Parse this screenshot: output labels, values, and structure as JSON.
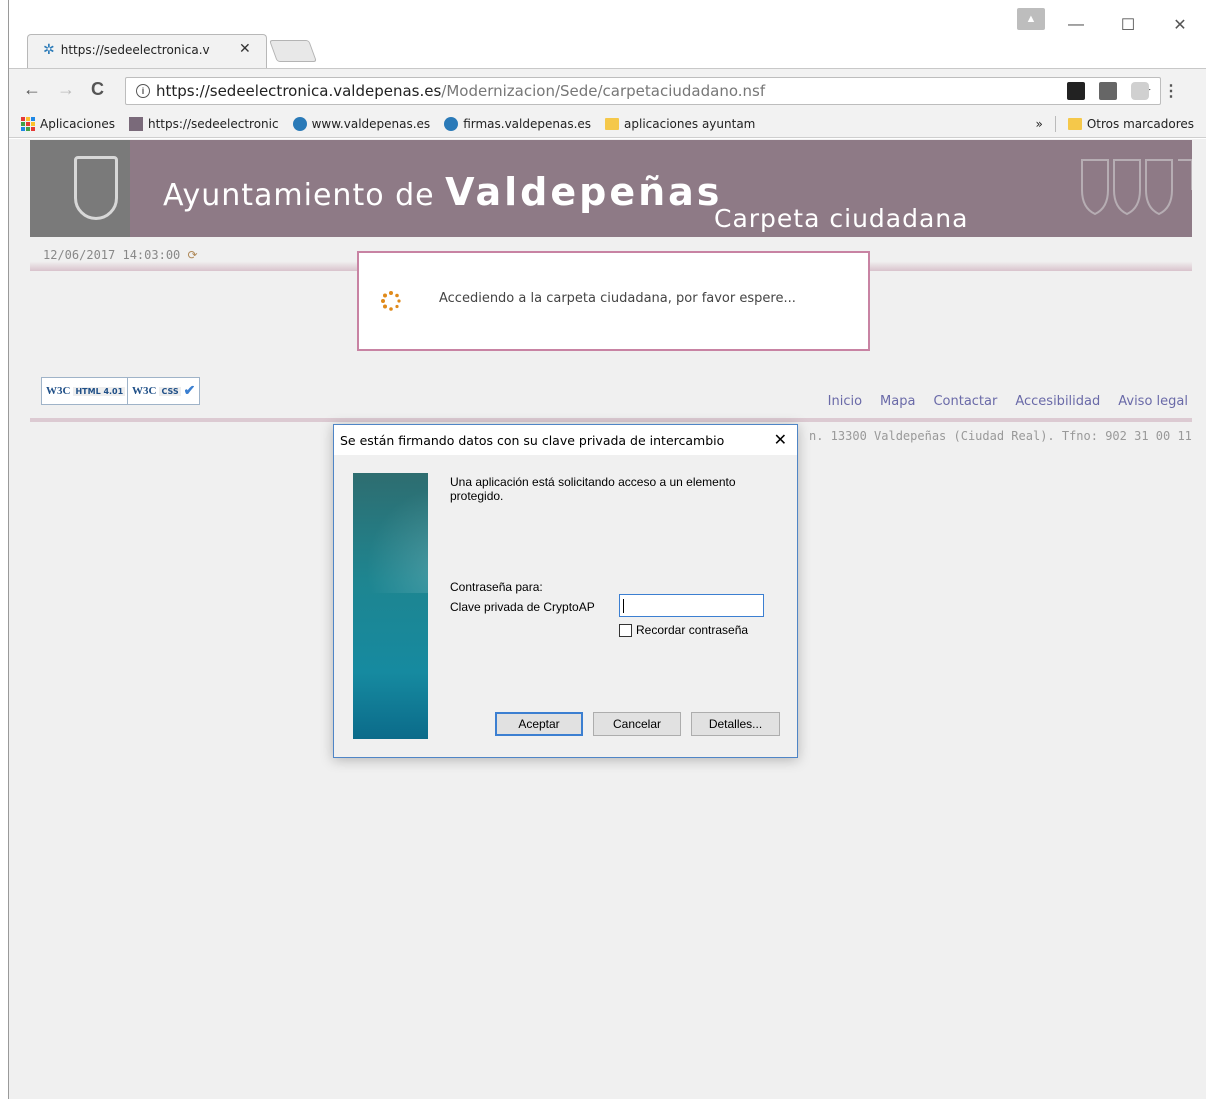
{
  "browser": {
    "tab_title": "https://sedeelectronica.v",
    "url_host": "https://sedeelectronica.valdepenas.es",
    "url_path": "/Modernizacion/Sede/carpetaciudadano.nsf",
    "bookmarks": [
      {
        "label": "Aplicaciones",
        "icon": "apps-grid-icon"
      },
      {
        "label": "https://sedeelectronic",
        "icon": "site-icon"
      },
      {
        "label": "www.valdepenas.es",
        "icon": "valdepenas-icon"
      },
      {
        "label": "firmas.valdepenas.es",
        "icon": "valdepenas-icon"
      },
      {
        "label": "aplicaciones ayuntam",
        "icon": "folder-icon"
      }
    ],
    "bookmarks_overflow": "»",
    "other_bookmarks": "Otros marcadores"
  },
  "page": {
    "banner_prefix": "Ayuntamiento de ",
    "banner_city": "Valdepeñas",
    "banner_sub": "Carpeta ciudadana",
    "datetime": "12/06/2017 14:03:00",
    "loading_text": "Accediendo a la carpeta ciudadana, por favor espere...",
    "badges": [
      {
        "w3c": "W3C",
        "spec": "HTML 4.01"
      },
      {
        "w3c": "W3C",
        "spec": "CSS"
      }
    ],
    "footer_links": [
      "Inicio",
      "Mapa",
      "Contactar",
      "Accesibilidad",
      "Aviso legal"
    ],
    "address": "n. 13300 Valdepeñas (Ciudad Real). Tfno: 902 31 00 11"
  },
  "dialog": {
    "title": "Se están firmando datos con su clave privada de intercambio",
    "message": "Una aplicación está solicitando acceso a un elemento protegido.",
    "password_for": "Contraseña para:",
    "key_name": "Clave privada de CryptoAP",
    "password_value": "",
    "remember": "Recordar contraseña",
    "accept": "Aceptar",
    "cancel": "Cancelar",
    "details": "Detalles..."
  },
  "colors": {
    "banner": "#8e7a86",
    "loading_border": "#c883a3",
    "link": "#6a6aa8",
    "dialog_accent": "#3c7fd1"
  }
}
